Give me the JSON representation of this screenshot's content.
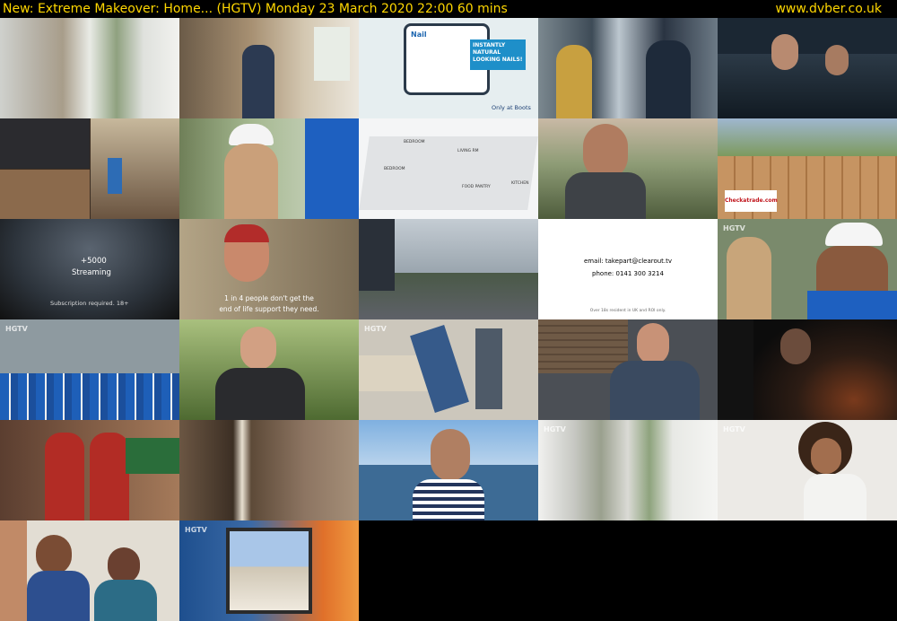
{
  "header": {
    "title": "New: Extreme Makeover: Home... (HGTV)    Monday 23 March 2020  22:00  60 mins",
    "site": "www.dvber.co.uk"
  },
  "colors": {
    "header_text": "#ffd700",
    "background": "#000000"
  },
  "thumbnails": {
    "t3": {
      "brand": "Nail",
      "headline": "INSTANTLY NATURAL LOOKING NAILS!",
      "footer": "Only at Boots"
    },
    "t12": {
      "line1": "+5000",
      "line2": "Streaming",
      "note": "Subscription required. 18+"
    },
    "t13": {
      "caption1": "1 in 4 people don't get the",
      "caption2": "end of life support they need."
    },
    "t15": {
      "email": "email: takepart@clearout.tv",
      "phone": "phone: 0141 300 3214",
      "note": "Over 18s resident in UK and ROI only."
    },
    "t10": {
      "sign": "Checkatrade.com"
    },
    "t7": {
      "room1": "BEDROOM",
      "room2": "LIVING RM",
      "room3": "BEDROOM",
      "room4": "FOOD PANTRY",
      "room5": "KITCHEN"
    },
    "channel_logo": "HGTV"
  }
}
